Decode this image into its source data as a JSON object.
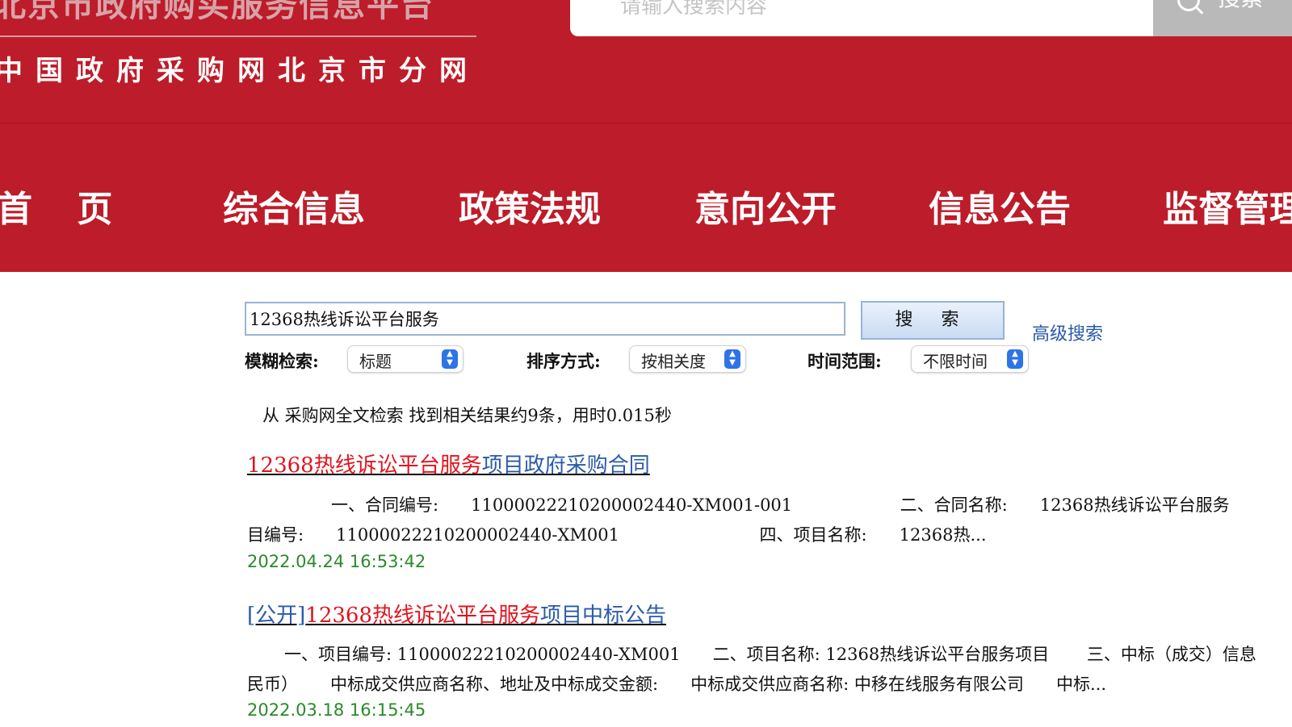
{
  "header": {
    "site_title": "北京市政府购买服务信息平台",
    "site_subtitle": "中国政府采购网北京市分网",
    "search_placeholder": "请输入搜索内容",
    "search_button": "搜索"
  },
  "nav": {
    "items": [
      "首 页",
      "综合信息",
      "政策法规",
      "意向公开",
      "信息公告",
      "监督管理"
    ]
  },
  "search": {
    "query": "12368热线诉讼平台服务",
    "button": "搜 索",
    "advanced_link": "高级搜索",
    "fuzzy_label": "模糊检索:",
    "fuzzy_value": "标题",
    "sort_label": "排序方式:",
    "sort_value": "按相关度",
    "time_label": "时间范围:",
    "time_value": "不限时间"
  },
  "results": {
    "summary": "从 采购网全文检索 找到相关结果约9条，用时0.015秒",
    "items": [
      {
        "prefix": "",
        "highlight": "12368热线诉讼平台服务",
        "suffix": "项目政府采购合同",
        "snippet_line1": "一、合同编号:      11000022210200002440-XM001-001                    二、合同名称:      12368热线诉讼平台服务",
        "snippet_line2": "目编号:      11000022210200002440-XM001                          四、项目名称:      12368热...",
        "date": "2022.04.24 16:53:42"
      },
      {
        "prefix": "[公开]",
        "highlight": "12368热线诉讼平台服务",
        "suffix": "项目中标公告",
        "snippet_line1": "一、项目编号: 11000022210200002440-XM001      二、项目名称: 12368热线诉讼平台服务项目       三、中标（成交）信息",
        "snippet_line2": "民币）      中标成交供应商名称、地址及中标成交金额:      中标成交供应商名称: 中移在线服务有限公司      中标...",
        "date": "2022.03.18 16:15:45"
      }
    ]
  },
  "colors": {
    "brand_red": "#bd1c2a",
    "highlight_red": "#e0141e",
    "link_blue": "#2b5aa8",
    "date_green": "#2a8a2a"
  }
}
